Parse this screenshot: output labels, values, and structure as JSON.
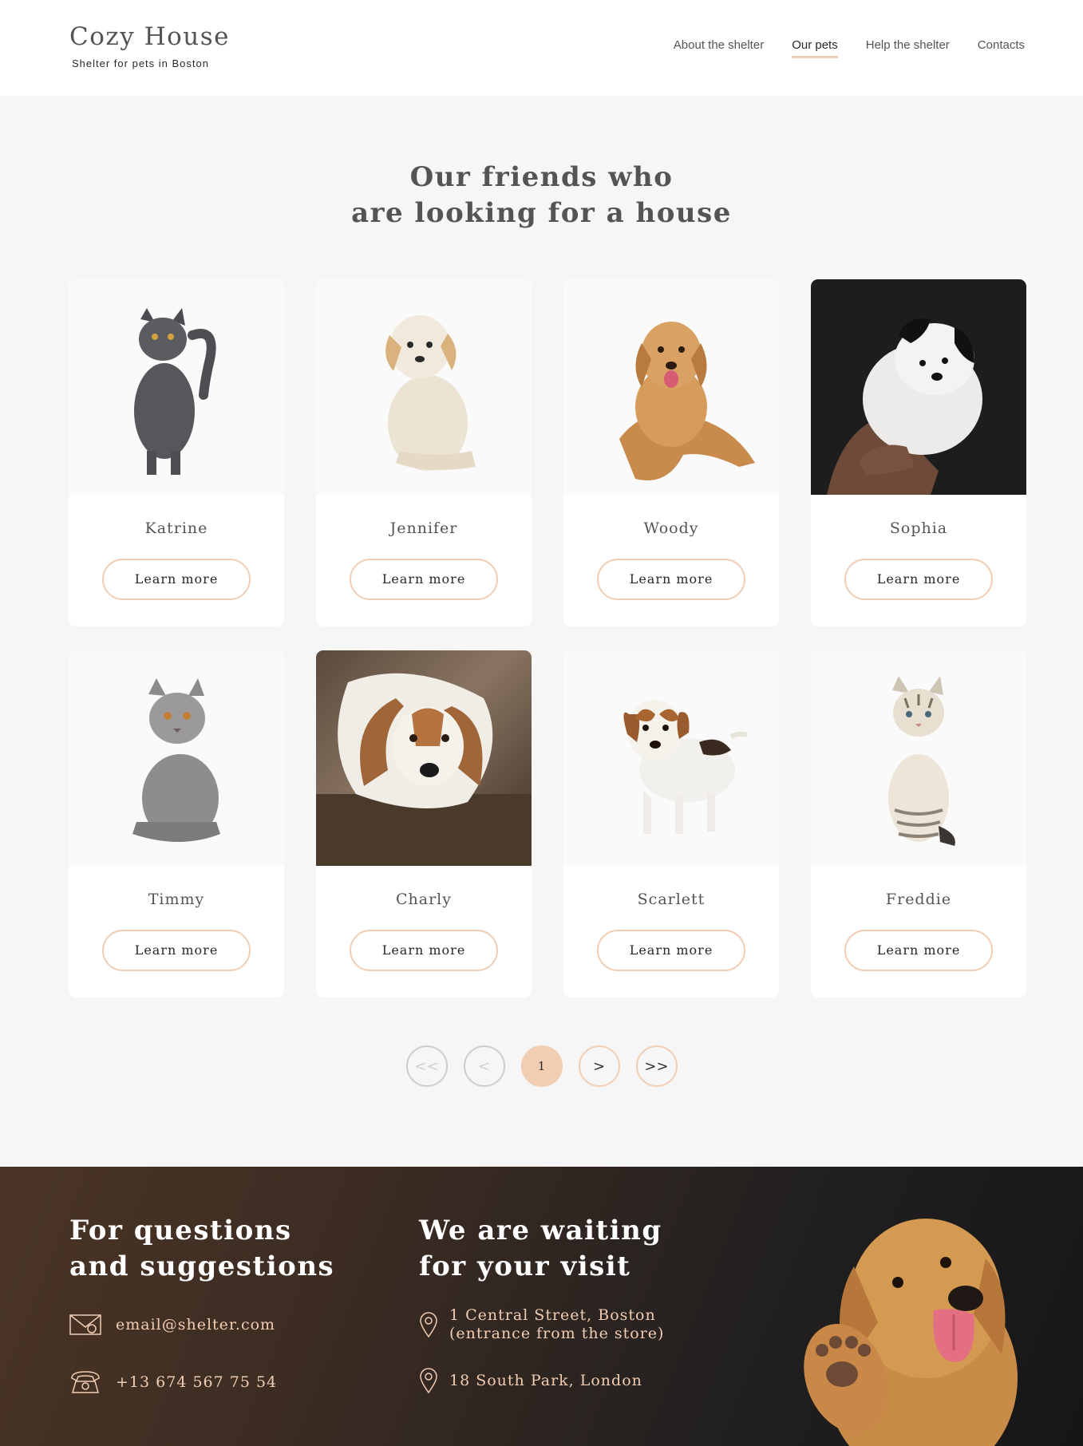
{
  "header": {
    "logo_title": "Cozy House",
    "logo_subtitle": "Shelter for pets in Boston",
    "nav": [
      {
        "label": "About the shelter",
        "active": false
      },
      {
        "label": "Our pets",
        "active": true
      },
      {
        "label": "Help the shelter",
        "active": false
      },
      {
        "label": "Contacts",
        "active": false
      }
    ]
  },
  "main": {
    "title_line1": "Our friends who",
    "title_line2": "are looking for a house",
    "learn_more_label": "Learn more",
    "pets": [
      {
        "name": "Katrine",
        "kind": "cat",
        "photo": "gray-cat"
      },
      {
        "name": "Jennifer",
        "kind": "dog",
        "photo": "cream-puppy"
      },
      {
        "name": "Woody",
        "kind": "dog",
        "photo": "golden-retriever"
      },
      {
        "name": "Sophia",
        "kind": "dog",
        "photo": "fluffy-puppy-in-hands"
      },
      {
        "name": "Timmy",
        "kind": "cat",
        "photo": "british-shorthair"
      },
      {
        "name": "Charly",
        "kind": "dog",
        "photo": "resting-dog"
      },
      {
        "name": "Scarlett",
        "kind": "dog",
        "photo": "jack-russell-puppy"
      },
      {
        "name": "Freddie",
        "kind": "cat",
        "photo": "tabby-kitten"
      }
    ],
    "pagination": {
      "first": "<<",
      "prev": "<",
      "current": "1",
      "next": ">",
      "last": ">>"
    }
  },
  "footer": {
    "questions_line1": "For questions",
    "questions_line2": "and suggestions",
    "email": "email@shelter.com",
    "phone": "+13 674 567 75 54",
    "visit_line1": "We are waiting",
    "visit_line2": "for your visit",
    "address1_line1": "1 Central Street, Boston",
    "address1_line2": "(entrance from the store)",
    "address2": "18 South Park, London",
    "icons": [
      "envelope-icon",
      "phone-icon",
      "location-pin-icon"
    ]
  },
  "colors": {
    "accent": "#f1cdb3",
    "text": "#545454",
    "dark": "#292929",
    "page_bg": "#f6f6f6"
  }
}
